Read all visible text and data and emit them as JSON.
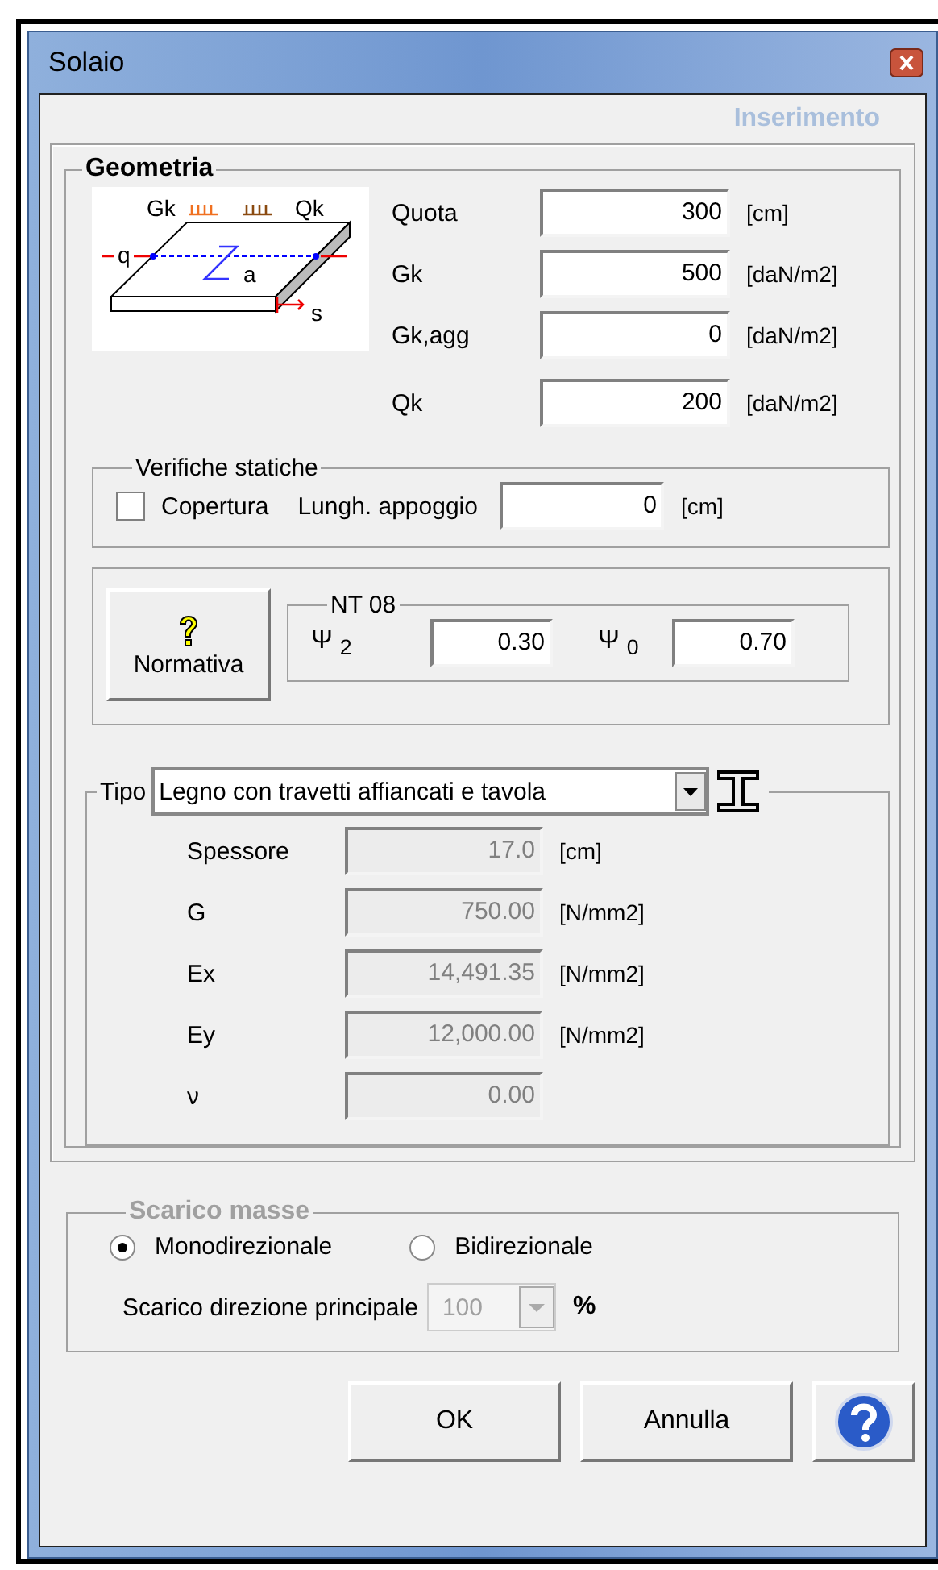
{
  "window": {
    "title": "Solaio",
    "mode": "Inserimento"
  },
  "geometria": {
    "title": "Geometria",
    "diagram_labels": [
      "Gk",
      "Qk",
      "q",
      "a",
      "s"
    ],
    "fields": [
      {
        "label": "Quota",
        "value": "300",
        "unit": "[cm]"
      },
      {
        "label": "Gk",
        "value": "500",
        "unit": "[daN/m2]"
      },
      {
        "label": "Gk,agg",
        "value": "0",
        "unit": "[daN/m2]"
      },
      {
        "label": "Qk",
        "value": "200",
        "unit": "[daN/m2]"
      }
    ]
  },
  "verifiche_statiche": {
    "title": "Verifiche statiche",
    "checkbox": {
      "label": "Copertura",
      "checked": false
    },
    "field": {
      "label": "Lungh. appoggio",
      "value": "0",
      "unit": "[cm]"
    }
  },
  "normativa": {
    "button": "Normativa",
    "group_title": "NT 08",
    "fields": [
      {
        "label": "Ψ $_{2}$",
        "value": "0.30"
      },
      {
        "label": "Ψ $_{0}$",
        "value": "0.70"
      }
    ]
  },
  "tipo": {
    "title": "Tipo",
    "selection": "Legno con travetti affiancati e tavola",
    "fields": [
      {
        "label": "Spessore",
        "value": "17.0",
        "unit": "[cm]",
        "disabled": true
      },
      {
        "label": "G",
        "value": "750.00",
        "unit": "[N/mm2]",
        "disabled": true
      },
      {
        "label": "Ex",
        "value": "14,491.35",
        "unit": "[N/mm2]",
        "disabled": true
      },
      {
        "label": "Ey",
        "value": "12,000.00",
        "unit": "[N/mm2]",
        "disabled": true
      },
      {
        "label": "ν",
        "value": "0.00",
        "disabled": true
      }
    ]
  },
  "scarico_masse": {
    "title": "Scarico masse",
    "disabled": true,
    "options": [
      {
        "label": "Monodirezionale",
        "selected": true
      },
      {
        "label": "Bidirezionale",
        "selected": false
      }
    ],
    "combo_label": "Scarico direzione principale",
    "combo_value": "100",
    "combo_disabled": true,
    "unit": "%"
  },
  "buttons": [
    {
      "kind": "text",
      "label": "OK"
    },
    {
      "kind": "text",
      "label": "Annulla"
    },
    {
      "kind": "help"
    }
  ]
}
